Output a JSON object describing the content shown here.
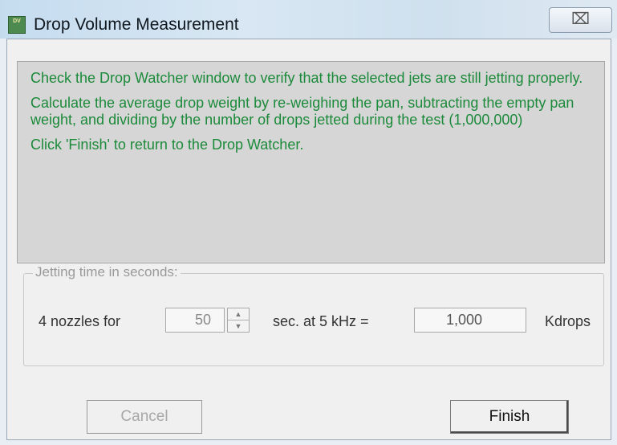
{
  "window": {
    "title": "Drop Volume Measurement",
    "close_glyph": "⌧",
    "app_icon_text": "DV"
  },
  "message": {
    "para1": "Check the Drop Watcher window to verify that the selected jets are still jetting properly.",
    "para2": "Calculate the average drop weight by re-weighing the pan, subtracting the empty pan weight, and dividing by the number of drops jetted during the test (1,000,000)",
    "para3": "Click 'Finish' to return to the Drop Watcher."
  },
  "jetting": {
    "group_label": "Jetting time in seconds:",
    "nozzles_label": "4 nozzles for",
    "seconds_value": "50",
    "sec_label": "sec. at 5 kHz =",
    "kdrops_value": "1,000",
    "kdrops_label": "Kdrops"
  },
  "buttons": {
    "cancel": "Cancel",
    "finish": "Finish"
  },
  "colors": {
    "message_text": "#1c8a3b",
    "message_background": "#d6d6d6"
  }
}
